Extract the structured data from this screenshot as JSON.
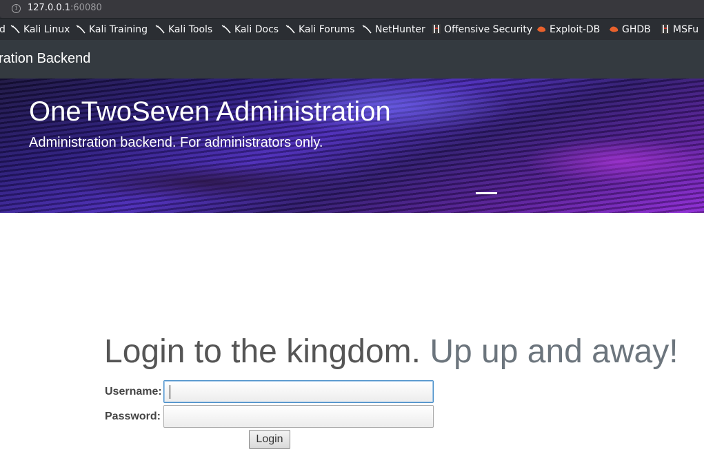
{
  "browser": {
    "url_host": "127.0.0.1",
    "url_port": ":60080",
    "bookmarks": [
      {
        "label": "d",
        "icon": "none"
      },
      {
        "label": "Kali Linux",
        "icon": "kali-dragon-icon"
      },
      {
        "label": "Kali Training",
        "icon": "kali-dragon-icon"
      },
      {
        "label": "Kali Tools",
        "icon": "kali-dragon-icon"
      },
      {
        "label": "Kali Docs",
        "icon": "kali-dragon-icon"
      },
      {
        "label": "Kali Forums",
        "icon": "kali-dragon-icon"
      },
      {
        "label": "NetHunter",
        "icon": "kali-dragon-icon"
      },
      {
        "label": "Offensive Security",
        "icon": "offsec-icon"
      },
      {
        "label": "Exploit-DB",
        "icon": "exploit-db-icon"
      },
      {
        "label": "GHDB",
        "icon": "exploit-db-icon"
      },
      {
        "label": "MSFu",
        "icon": "offsec-icon"
      }
    ]
  },
  "navbar": {
    "brand": "ration Backend"
  },
  "banner": {
    "title": "OneTwoSeven Administration",
    "subtitle": "Administration backend. For administrators only."
  },
  "login": {
    "heading_main": "Login to the kingdom.",
    "heading_muted": "Up up and away!",
    "username_label": "Username:",
    "username_value": "",
    "password_label": "Password:",
    "password_value": "",
    "submit_label": "Login"
  },
  "colors": {
    "navbar_bg": "#343a40",
    "toolbar_bg": "#2b2e33",
    "heading_text": "#555555",
    "heading_muted": "#6c757d",
    "focus_border": "#4a8fc9"
  }
}
